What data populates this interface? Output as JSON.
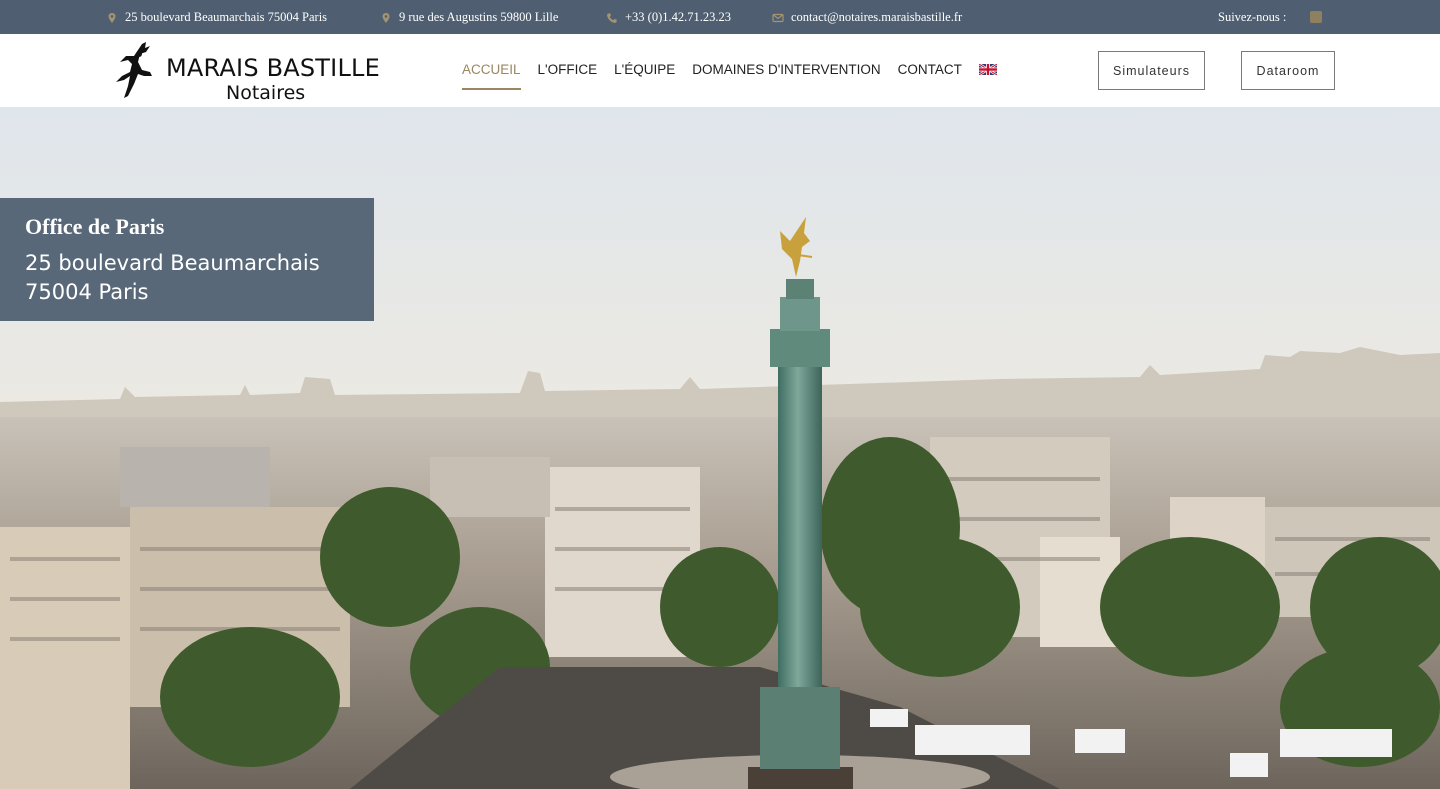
{
  "topbar": {
    "address_paris": "25 boulevard Beaumarchais 75004 Paris",
    "address_lille": "9 rue des Augustins 59800 Lille",
    "phone": "+33 (0)1.42.71.23.23",
    "email": "contact@notaires.maraisbastille.fr",
    "follow_label": "Suivez-nous :",
    "icons": [
      "map-pin-icon",
      "map-pin-icon",
      "phone-icon",
      "mail-icon",
      "social-icon"
    ]
  },
  "header": {
    "logo_title": "MARAIS BASTILLE",
    "logo_subtitle": "Notaires",
    "nav": [
      {
        "label": "ACCUEIL",
        "active": true
      },
      {
        "label": "L'OFFICE",
        "active": false
      },
      {
        "label": "L'ÉQUIPE",
        "active": false
      },
      {
        "label": "DOMAINES D'INTERVENTION",
        "active": false
      },
      {
        "label": "CONTACT",
        "active": false
      }
    ],
    "language_flag": "uk-flag-icon",
    "simulators_label": "Simulateurs",
    "dataroom_label": "Dataroom"
  },
  "hero": {
    "card_title": "Office de Paris",
    "card_line1": "25 boulevard Beaumarchais",
    "card_line2": "75004 Paris"
  },
  "colors": {
    "topbar_bg": "#4f5f71",
    "accent_gold": "#9a8660",
    "card_bg": "#4f6072"
  }
}
